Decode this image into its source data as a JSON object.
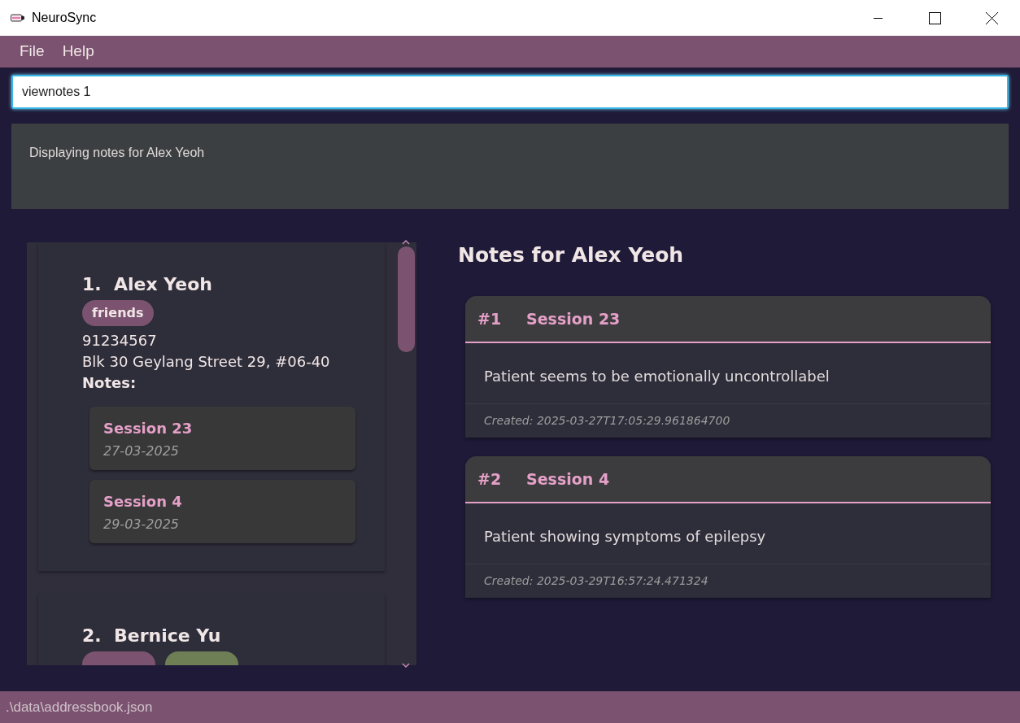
{
  "window": {
    "title": "NeuroSync"
  },
  "menu": [
    "File",
    "Help"
  ],
  "command": {
    "value": "viewnotes 1"
  },
  "result": "Displaying notes for Alex Yeoh",
  "persons": [
    {
      "index": "1.",
      "name": "Alex Yeoh",
      "tags": [
        {
          "label": "friends",
          "color": "#7b5370"
        }
      ],
      "phone": "91234567",
      "address": "Blk 30 Geylang Street 29, #06-40",
      "notes_label": "Notes:",
      "notes": [
        {
          "title": "Session 23",
          "date": "27-03-2025"
        },
        {
          "title": "Session 4",
          "date": "29-03-2025"
        }
      ]
    },
    {
      "index": "2.",
      "name": "Bernice Yu",
      "tags": [
        {
          "color": "#7b5370"
        },
        {
          "color": "#6e7f55"
        }
      ]
    }
  ],
  "notes_panel": {
    "title": "Notes for Alex Yeoh",
    "notes": [
      {
        "number": "#1",
        "title": "Session 23",
        "body": "Patient seems to be emotionally uncontrollabel",
        "created": "Created: 2025-03-27T17:05:29.961864700"
      },
      {
        "number": "#2",
        "title": "Session 4",
        "body": "Patient showing symptoms of epilepsy",
        "created": "Created: 2025-03-29T16:57:24.471324"
      }
    ]
  },
  "status_bar": ".\\data\\addressbook.json"
}
